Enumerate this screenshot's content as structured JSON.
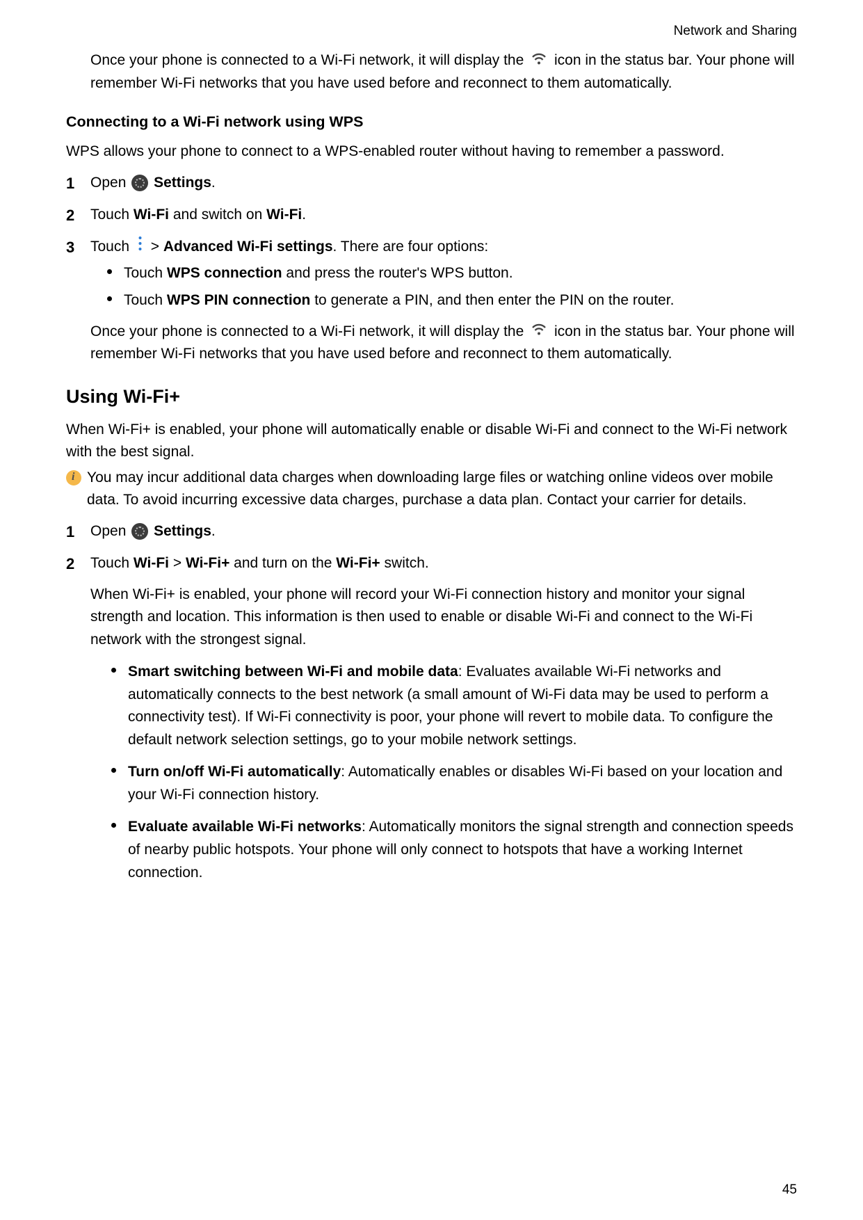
{
  "header": "Network and Sharing",
  "intro_para_a": "Once your phone is connected to a Wi-Fi network, it will display the ",
  "intro_para_b": " icon in the status bar. Your phone will remember Wi-Fi networks that you have used before and reconnect to them automatically.",
  "sect1_title": "Connecting to a Wi-Fi network using WPS",
  "sect1_intro": "WPS allows your phone to connect to a WPS-enabled router without having to remember a password.",
  "s1_open": "Open ",
  "s1_settings": " Settings",
  "dot": ".",
  "s2_a": "Touch ",
  "s2_b": "Wi-Fi",
  "s2_c": " and switch on ",
  "s2_d": "Wi-Fi",
  "s3_a": "Touch ",
  "s3_b": "  > ",
  "s3_c": "Advanced Wi-Fi settings",
  "s3_d": ". There are four options:",
  "s3_b1_a": "Touch ",
  "s3_b1_b": "WPS connection",
  "s3_b1_c": " and press the router's WPS button.",
  "s3_b2_a": "Touch ",
  "s3_b2_b": "WPS PIN connection",
  "s3_b2_c": " to generate a PIN, and then enter the PIN on the router.",
  "s3_outro_a": "Once your phone is connected to a Wi-Fi network, it will display the ",
  "s3_outro_b": " icon in the status bar. Your phone will remember Wi-Fi networks that you have used before and reconnect to them automatically.",
  "h2": "Using Wi-Fi+",
  "wfp_intro": "When Wi-Fi+ is enabled, your phone will automatically enable or disable Wi-Fi and connect to the Wi-Fi network with the best signal.",
  "wfp_info": "You may incur additional data charges when downloading large files or watching online videos over mobile data. To avoid incurring excessive data charges, purchase a data plan. Contact your carrier for details.",
  "w1_open": "Open ",
  "w1_settings": " Settings",
  "w2_a": "Touch ",
  "w2_b": "Wi-Fi",
  "w2_c": " > ",
  "w2_d": "Wi-Fi+",
  "w2_e": " and turn on the ",
  "w2_f": "Wi-Fi+",
  "w2_g": " switch.",
  "w2_para": "When Wi-Fi+ is enabled, your phone will record your Wi-Fi connection history and monitor your signal strength and location. This information is then used to enable or disable Wi-Fi and connect to the Wi-Fi network with the strongest signal.",
  "bA_t": "Smart switching between Wi-Fi and mobile data",
  "bA_d": ": Evaluates available Wi-Fi networks and automatically connects to the best network (a small amount of Wi-Fi data may be used to perform a connectivity test). If Wi-Fi connectivity is poor, your phone will revert to mobile data. To configure the default network selection settings, go to your mobile network settings.",
  "bB_t": "Turn on/off Wi-Fi automatically",
  "bB_d": ": Automatically enables or disables Wi-Fi based on your location and your Wi-Fi connection history.",
  "bC_t": "Evaluate available Wi-Fi networks",
  "bC_d": ": Automatically monitors the signal strength and connection speeds of nearby public hotspots. Your phone will only connect to hotspots that have a working Internet connection.",
  "pagenum": "45"
}
